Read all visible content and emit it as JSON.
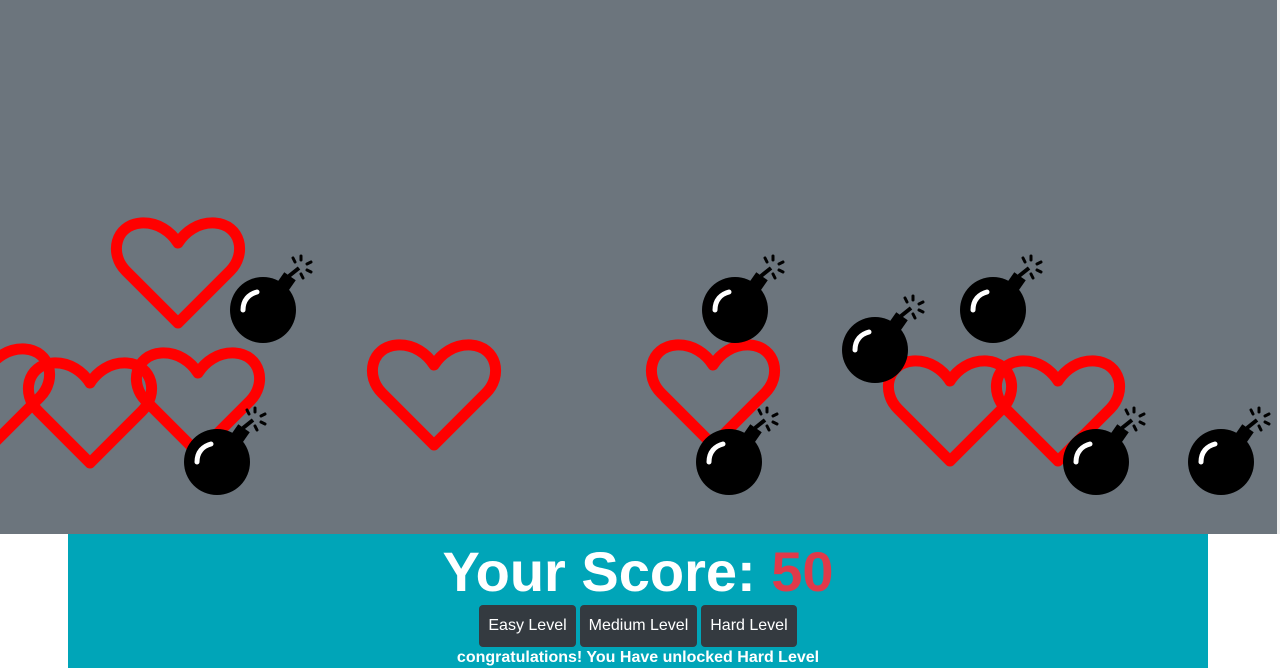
{
  "game": {
    "background_color": "#6c757d",
    "heart_color": "#ff0000",
    "bomb_color": "#000000",
    "heart_icon": "heart-outline-icon",
    "bomb_icon": "bomb-icon"
  },
  "score": {
    "label": "Your Score:",
    "value": "50",
    "value_color": "#e03a4a"
  },
  "levels": {
    "easy_label": "Easy Level",
    "medium_label": "Medium Level",
    "hard_label": "Hard Level"
  },
  "message": "congratulations! You Have unlocked Hard Level",
  "colors": {
    "panel": "#00a5b8",
    "button": "#343a40"
  }
}
